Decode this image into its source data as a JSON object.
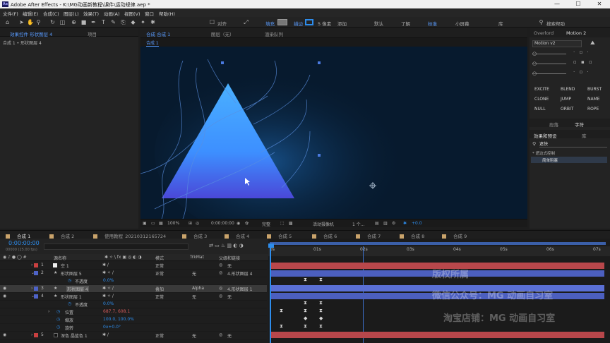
{
  "app": {
    "logo": "Ae",
    "title": "Adobe After Effects - K:\\MG动画新教程\\课件\\运动规律.aep *"
  },
  "window": {
    "minimize": "—",
    "maximize": "☐",
    "close": "✕"
  },
  "menu": [
    "文件(F)",
    "编辑(E)",
    "合成(C)",
    "图层(L)",
    "效果(T)",
    "动画(A)",
    "视图(V)",
    "窗口",
    "帮助(H)"
  ],
  "toolbar": {
    "snap": "对齐",
    "fill": "填充",
    "stroke": "描边",
    "stroke_px": "5 像素",
    "add": "添加",
    "workspaces": [
      "默认",
      "了解",
      "标准",
      "小屏幕",
      "库"
    ],
    "search": "搜索帮助"
  },
  "left_panel": {
    "tabs": [
      "效果控件 形状图层 4",
      "项目"
    ],
    "breadcrumb": "合成 1 • 形状图层 4"
  },
  "viewer": {
    "tabs": [
      "合成 合成 1",
      "图层（无）",
      "渲染队列"
    ],
    "sub_tab": "合成 1"
  },
  "viewbar": {
    "zoom": "100%",
    "time": "0:00:00:00",
    "quality": "完整",
    "camera": "活动摄像机",
    "views": "1 个...",
    "exposure": "+0.0"
  },
  "right": {
    "tabs": [
      "Overlord",
      "Motion 2"
    ],
    "motion_version": "Motion v2",
    "buttons": [
      "EXCITE",
      "BLEND",
      "BURST",
      "CLONE",
      "JUMP",
      "NAME",
      "NULL",
      "ORBIT",
      "ROPE"
    ],
    "para_tab": "段落",
    "char_tab": "字符",
    "effects_tab": "效果和预设",
    "library_tab": "库",
    "search_value": "遮快",
    "category": "* 遮边式控制",
    "result": "简单阻塞"
  },
  "timeline": {
    "tabs": [
      "合成 1",
      "合成 2",
      "使用教程_20210312165724",
      "合成 3",
      "合成 4",
      "合成 5",
      "合成 6",
      "合成 7",
      "合成 8",
      "合成 9"
    ],
    "timecode": "0:00:00:00",
    "fps": "00000 (25.00 fps)",
    "headers": {
      "name": "源名称",
      "mode": "模式",
      "trkmat": "TrkMat",
      "parent": "父级和链接"
    },
    "ruler": [
      "0s",
      "01s",
      "02s",
      "03s",
      "04s",
      "05s",
      "06s",
      "07s"
    ],
    "layers": [
      {
        "num": "1",
        "name": "空 1",
        "mode": "正常",
        "trk": "",
        "parent": "无",
        "color": "#c94040"
      },
      {
        "num": "2",
        "name": "形状图层 5",
        "mode": "正常",
        "trk": "无",
        "parent": "4.形状图层 4",
        "color": "#4e63c8"
      },
      {
        "num": "",
        "name": "不透度",
        "mode": "",
        "trk": "",
        "parent": "",
        "color": ""
      },
      {
        "num": "3",
        "name": "形状图层 4",
        "mode": "叠加",
        "trk": "Alpha",
        "parent": "4.形状图层 1",
        "color": "#4e63c8"
      },
      {
        "num": "4",
        "name": "形状图层 1",
        "mode": "正常",
        "trk": "无",
        "parent": "无",
        "color": "#4e63c8"
      },
      {
        "num": "",
        "name": "不透度",
        "mode": "",
        "trk": "",
        "parent": "",
        "color": ""
      },
      {
        "num": "",
        "name": "位置",
        "mode": "",
        "trk": "",
        "parent": "",
        "color": ""
      },
      {
        "num": "",
        "name": "缩放",
        "mode": "",
        "trk": "",
        "parent": "",
        "color": ""
      },
      {
        "num": "",
        "name": "旋转",
        "mode": "",
        "trk": "",
        "parent": "",
        "color": ""
      },
      {
        "num": "5",
        "name": "深色 晶蓝色 1",
        "mode": "正常",
        "trk": "无",
        "parent": "无",
        "color": "#c94040"
      }
    ],
    "values": {
      "opacity2": "0.0%",
      "opacity4": "0.0%",
      "position": "687.7, 608.1",
      "scale": "100.0, 100.0%",
      "rotation": "0x+0.0°"
    }
  },
  "watermark": [
    "版权所属",
    "微信公众号：MG 动画自习室",
    "淘宝店铺：MG 动画自习室"
  ],
  "colors": {
    "accent": "#2d8ceb",
    "viewer_bg": "#071a2e",
    "triangle_top": "#4aa8ff",
    "triangle_bottom": "#3b4fd9",
    "layer_bar_red": "#b8474b",
    "layer_bar_blue": "#4c5fbf"
  }
}
